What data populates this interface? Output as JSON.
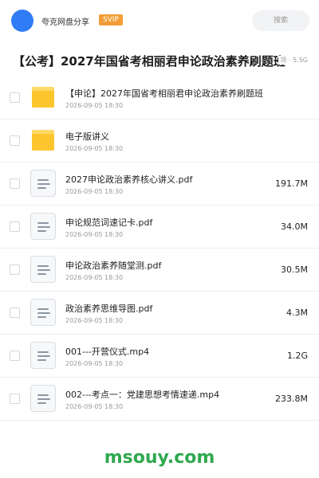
{
  "header": {
    "share_name": "夸克网盘分享",
    "badge": "SVIP",
    "search_placeholder": "搜索"
  },
  "folder": {
    "title": "【公考】2027年国省考相丽君申论政治素养刷题班",
    "meta": "项 · 5.5G"
  },
  "files": [
    {
      "type": "folder",
      "name": "【申论】2027年国省考相丽君申论政治素养刷题班",
      "date": "2026-09-05 18:30",
      "size": ""
    },
    {
      "type": "folder",
      "name": "电子版讲义",
      "date": "2026-09-05 18:30",
      "size": ""
    },
    {
      "type": "file",
      "name": "2027申论政治素养核心讲义.pdf",
      "date": "2026-09-05 18:30",
      "size": "191.7M"
    },
    {
      "type": "file",
      "name": "申论规范词速记卡.pdf",
      "date": "2026-09-05 18:30",
      "size": "34.0M"
    },
    {
      "type": "file",
      "name": "申论政治素养随堂测.pdf",
      "date": "2026-09-05 18:30",
      "size": "30.5M"
    },
    {
      "type": "file",
      "name": "政治素养思维导图.pdf",
      "date": "2026-09-05 18:30",
      "size": "4.3M"
    },
    {
      "type": "file",
      "name": "001---开营仪式.mp4",
      "date": "2026-09-05 18:30",
      "size": "1.2G"
    },
    {
      "type": "file",
      "name": "002---考点一：党建思想考情速递.mp4",
      "date": "2026-09-05 18:30",
      "size": "233.8M"
    }
  ],
  "watermark": "msouy.com",
  "colors": {
    "avatar": "#2f7cf6",
    "svip_badge": "#f39c35",
    "folder_icon": "#fdc62e",
    "watermark": "#2fa84f"
  }
}
